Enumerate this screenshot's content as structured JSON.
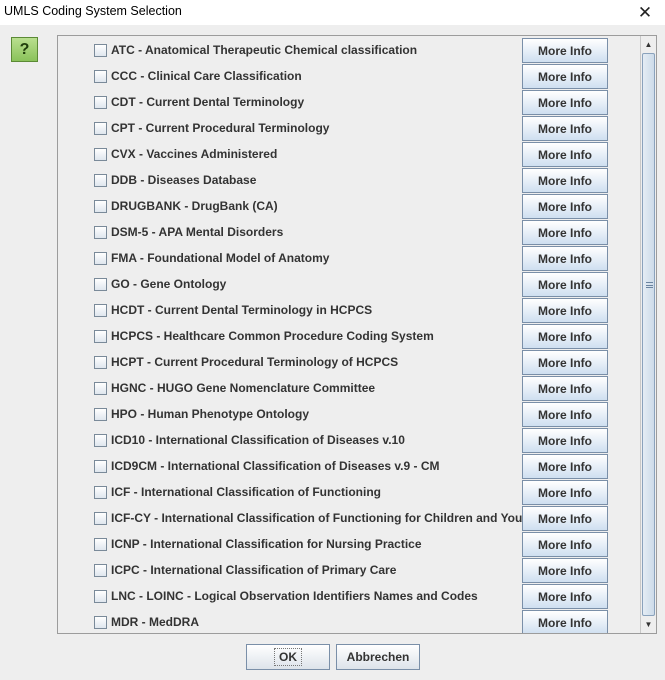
{
  "window": {
    "title": "UMLS Coding System Selection",
    "close_glyph": "✕"
  },
  "help_button": {
    "icon": "help-icon",
    "glyph": "?",
    "color": "#8ac25a"
  },
  "list": {
    "more_info_label": "More Info",
    "items": [
      "ATC - Anatomical Therapeutic Chemical classification",
      "CCC - Clinical Care Classification",
      "CDT - Current Dental Terminology",
      "CPT - Current Procedural Terminology",
      "CVX - Vaccines Administered",
      "DDB - Diseases Database",
      "DRUGBANK - DrugBank (CA)",
      "DSM-5 - APA Mental Disorders",
      "FMA - Foundational Model of Anatomy",
      "GO - Gene Ontology",
      "HCDT - Current Dental Terminology in HCPCS",
      "HCPCS - Healthcare Common Procedure Coding System",
      "HCPT - Current Procedural Terminology of HCPCS",
      "HGNC - HUGO Gene Nomenclature Committee",
      "HPO - Human Phenotype Ontology",
      "ICD10 - International Classification of Diseases v.10",
      "ICD9CM - International Classification of Diseases v.9 - CM",
      "ICF - International Classification of Functioning",
      "ICF-CY - International Classification of Functioning for Children and Youth",
      "ICNP - International Classification for Nursing Practice",
      "ICPC - International Classification of Primary Care",
      "LNC - LOINC - Logical Observation Identifiers Names and Codes",
      "MDR - MedDRA"
    ]
  },
  "scrollbar": {
    "up_glyph": "▲",
    "down_glyph": "▼"
  },
  "buttons": {
    "ok": "OK",
    "cancel": "Abbrechen"
  }
}
